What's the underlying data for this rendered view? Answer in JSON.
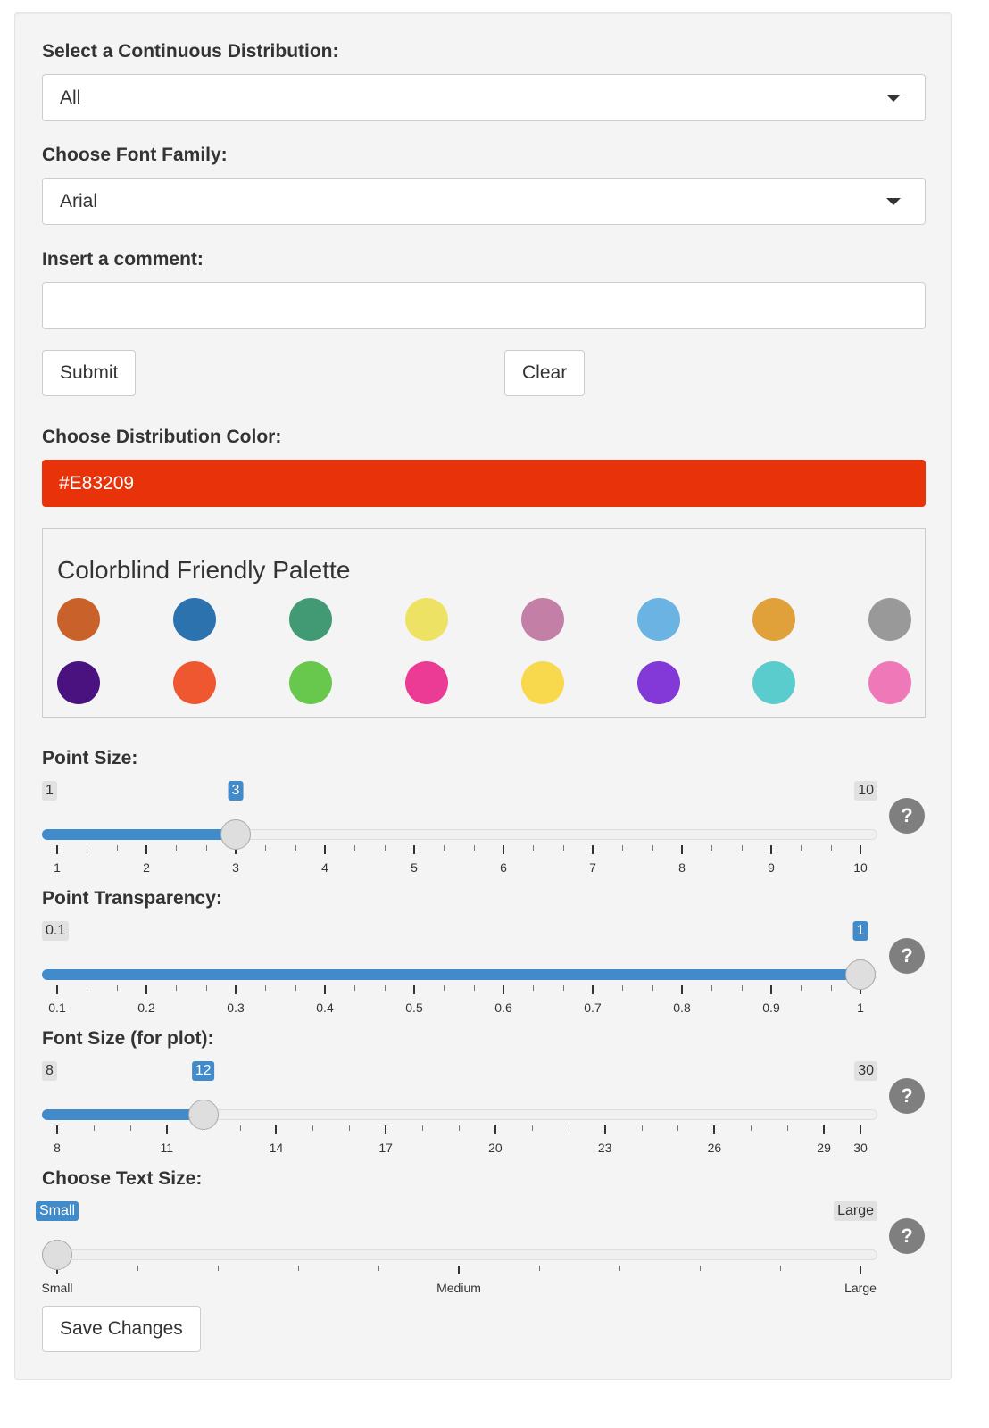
{
  "distribution": {
    "label": "Select a Continuous Distribution:",
    "value": "All"
  },
  "font_family": {
    "label": "Choose Font Family:",
    "value": "Arial"
  },
  "comment": {
    "label": "Insert a comment:",
    "value": "",
    "placeholder": ""
  },
  "buttons": {
    "submit": "Submit",
    "clear": "Clear",
    "save": "Save Changes"
  },
  "color": {
    "label": "Choose Distribution Color:",
    "value": "#E83209",
    "hex": "#E83209"
  },
  "palette": {
    "title": "Colorblind Friendly Palette",
    "colors": [
      "#C8622A",
      "#2C72AE",
      "#429A74",
      "#EEE264",
      "#C47FA6",
      "#6BB3E3",
      "#E0A13A",
      "#999999",
      "#4A127E",
      "#EE5730",
      "#68C84E",
      "#EB3B94",
      "#F8D84C",
      "#8339D8",
      "#5BCCCD",
      "#EF79B8"
    ]
  },
  "point_size": {
    "label": "Point Size:",
    "min": "1",
    "max": "10",
    "value": "3",
    "min_num": 1,
    "max_num": 10,
    "value_num": 3,
    "ticks": [
      "1",
      "2",
      "3",
      "4",
      "5",
      "6",
      "7",
      "8",
      "9",
      "10"
    ]
  },
  "point_transparency": {
    "label": "Point Transparency:",
    "min": "0.1",
    "max": "1",
    "value": "1",
    "min_num": 0.1,
    "max_num": 1,
    "value_num": 1,
    "ticks": [
      "0.1",
      "0.2",
      "0.3",
      "0.4",
      "0.5",
      "0.6",
      "0.7",
      "0.8",
      "0.9",
      "1"
    ]
  },
  "font_size": {
    "label": "Font Size (for plot):",
    "min": "8",
    "max": "30",
    "value": "12",
    "min_num": 8,
    "max_num": 30,
    "value_num": 12,
    "ticks": [
      "8",
      "11",
      "14",
      "17",
      "20",
      "23",
      "26",
      "29",
      "30"
    ]
  },
  "text_size": {
    "label": "Choose Text Size:",
    "min": "Small",
    "max": "Large",
    "value": "Small",
    "value_num": 0,
    "ticks": [
      "Small",
      "Medium",
      "Large"
    ]
  },
  "help_glyph": "?"
}
